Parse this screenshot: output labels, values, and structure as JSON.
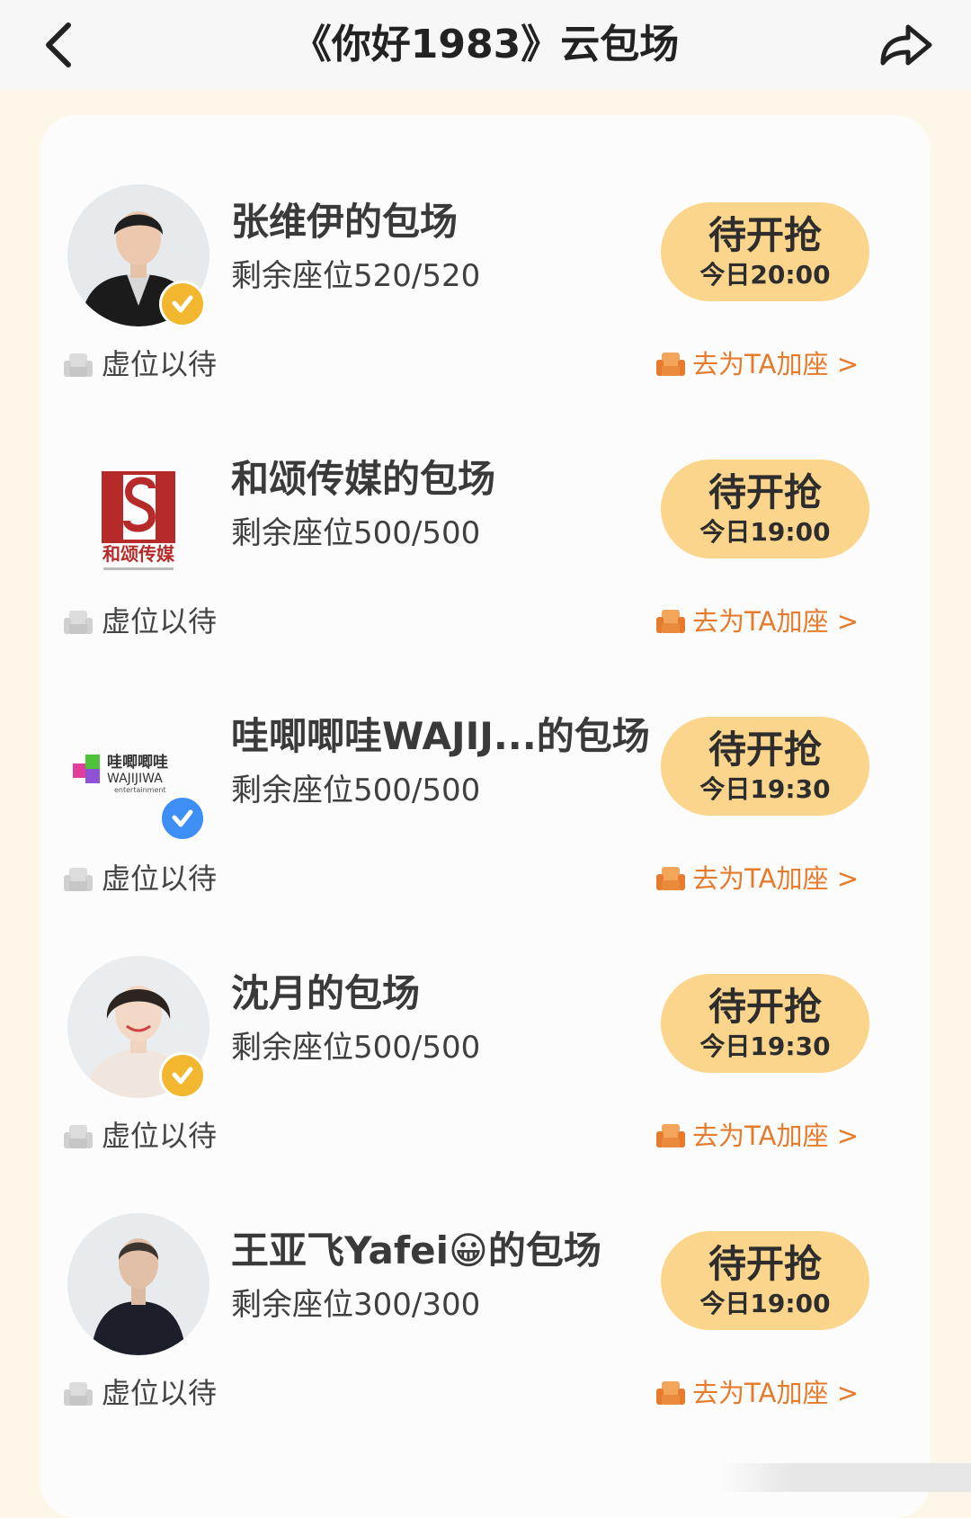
{
  "header": {
    "title": "《你好1983》云包场",
    "back_icon": "chevron-left-icon",
    "share_icon": "share-arrow-icon"
  },
  "colors": {
    "button_bg": "#fcd58c",
    "accent_orange": "#e77b2c",
    "badge_gold": "#f2b72f",
    "badge_blue": "#3d8ff5"
  },
  "cards": [
    {
      "title": "张维伊的包场",
      "seats": "剩余座位520/520",
      "button_label": "待开抢",
      "button_time": "今日20:00",
      "status": "虚位以待",
      "action": "去为TA加座 >",
      "avatar_type": "person-photo",
      "badge": "gold-verified-icon"
    },
    {
      "title": "和颂传媒的包场",
      "seats": "剩余座位500/500",
      "button_label": "待开抢",
      "button_time": "今日19:00",
      "status": "虚位以待",
      "action": "去为TA加座 >",
      "avatar_type": "company-logo",
      "logo_text": "和颂传媒"
    },
    {
      "title": "哇唧唧哇WAJIJ...的包场",
      "seats": "剩余座位500/500",
      "button_label": "待开抢",
      "button_time": "今日19:30",
      "status": "虚位以待",
      "action": "去为TA加座 >",
      "avatar_type": "company-logo",
      "logo_text": "哇唧唧哇 WAJIJIWA entertainment",
      "badge": "blue-verified-icon"
    },
    {
      "title": "沈月的包场",
      "seats": "剩余座位500/500",
      "button_label": "待开抢",
      "button_time": "今日19:30",
      "status": "虚位以待",
      "action": "去为TA加座 >",
      "avatar_type": "person-photo",
      "badge": "gold-verified-icon"
    },
    {
      "title": "王亚飞Yafei😀的包场",
      "seats": "剩余座位300/300",
      "button_label": "待开抢",
      "button_time": "今日19:00",
      "status": "虚位以待",
      "action": "去为TA加座 >",
      "avatar_type": "person-photo"
    }
  ]
}
